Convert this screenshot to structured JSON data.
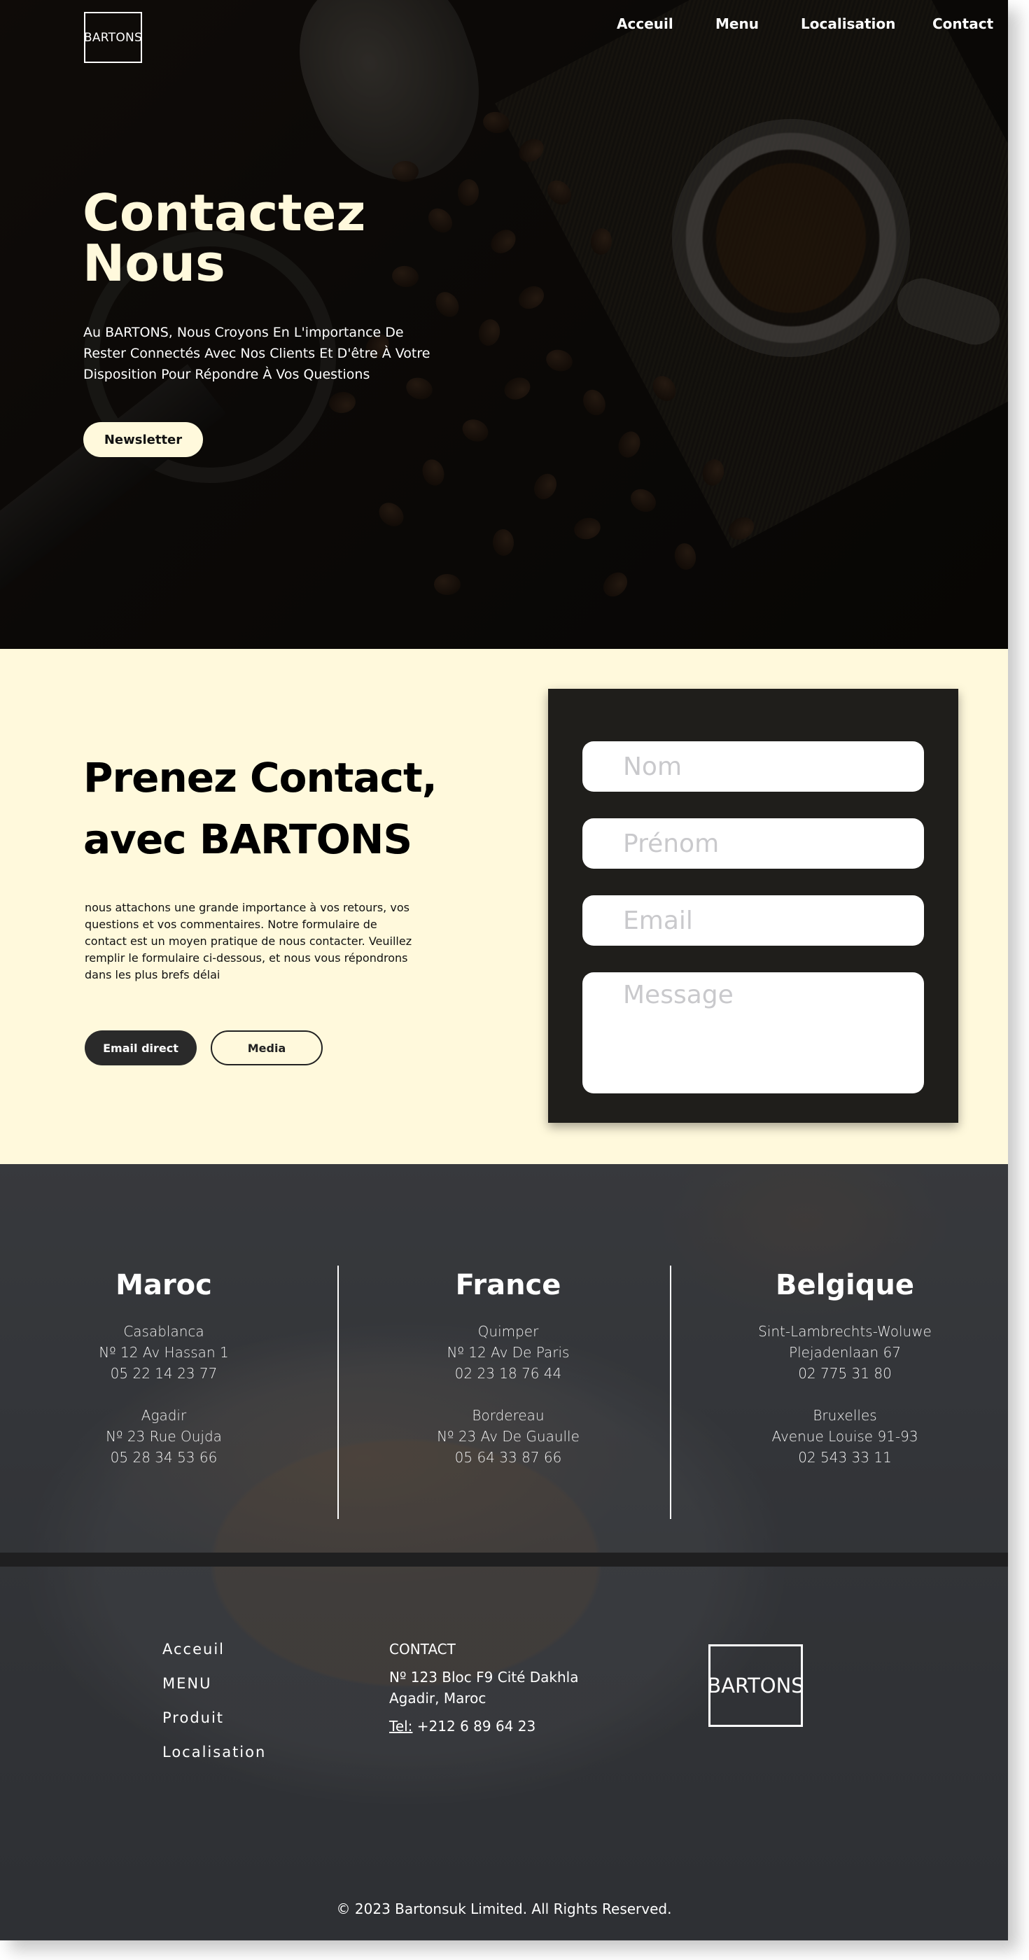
{
  "header": {
    "logo": "BARTONS",
    "nav": [
      "Acceuil",
      "Menu",
      "Localisation",
      "Contact"
    ]
  },
  "hero": {
    "title_line1": "Contactez",
    "title_line2": "Nous",
    "intro": "Au BARTONS, Nous Croyons En L'importance De Rester Connectés Avec Nos Clients Et D'être À Votre Disposition Pour Répondre À Vos Questions",
    "newsletter_button": "Newsletter"
  },
  "contact": {
    "title_line1": "Prenez Contact,",
    "title_line2": "avec BARTONS",
    "description": "nous attachons une grande importance à vos retours, vos questions et vos commentaires. Notre formulaire de contact est un moyen pratique de nous contacter. Veuillez remplir le formulaire ci-dessous, et nous vous répondrons dans les plus brefs délai",
    "email_button": "Email direct",
    "media_button": "Media",
    "form": {
      "nom_placeholder": "Nom",
      "prenom_placeholder": "Prénom",
      "email_placeholder": "Email",
      "message_placeholder": "Message"
    }
  },
  "locations": [
    {
      "country": "Maroc",
      "offices": [
        {
          "city": "Casablanca",
          "address": "Nº 12 Av Hassan 1",
          "phone": "05 22 14 23 77"
        },
        {
          "city": "Agadir",
          "address": "Nº 23 Rue Oujda",
          "phone": "05 28 34 53 66"
        }
      ]
    },
    {
      "country": "France",
      "offices": [
        {
          "city": "Quimper",
          "address": "Nº 12 Av De Paris",
          "phone": "02 23 18 76 44"
        },
        {
          "city": "Bordereau",
          "address": "Nº 23 Av De Guaulle",
          "phone": "05 64 33 87 66"
        }
      ]
    },
    {
      "country": "Belgique",
      "offices": [
        {
          "city": "Sint-Lambrechts-Woluwe",
          "address": "Plejadenlaan 67",
          "phone": "02 775 31 80"
        },
        {
          "city": "Bruxelles",
          "address": "Avenue Louise 91-93",
          "phone": "02 543 33 11"
        }
      ]
    }
  ],
  "footer": {
    "links": [
      "Acceuil",
      "MENU",
      "Produit",
      "Localisation"
    ],
    "contact_heading": "CONTACT",
    "address": "Nº 123 Bloc F9 Cité Dakhla Agadir, Maroc",
    "tel_label": "Tel:",
    "tel_value": " +212 6 89 64 23",
    "logo": "BARTONS",
    "copyright": "© 2023 Bartonsuk Limited. All Rights Reserved."
  },
  "colors": {
    "cream": "#fff9dc",
    "dark_card": "#1f1e1b",
    "button_dark": "#2a2a2a"
  }
}
